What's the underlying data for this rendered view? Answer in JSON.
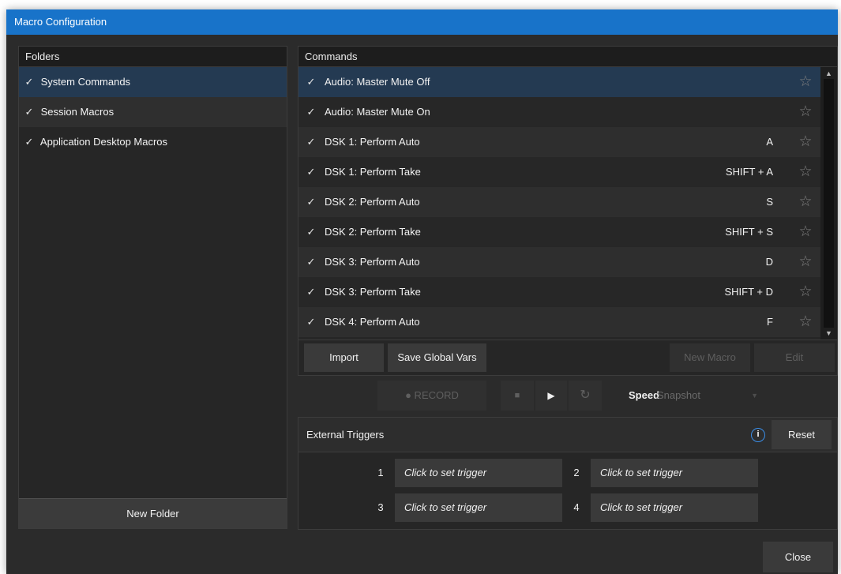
{
  "window": {
    "title": "Macro Configuration"
  },
  "folders": {
    "header": "Folders",
    "items": [
      {
        "check": "✓",
        "label": "System Commands"
      },
      {
        "check": "✓",
        "label": "Session Macros"
      },
      {
        "check": "✓",
        "label": "Application Desktop Macros"
      }
    ],
    "new_folder_label": "New Folder"
  },
  "commands": {
    "header": "Commands",
    "rows": [
      {
        "check": "✓",
        "label": "Audio: Master Mute Off",
        "key": "",
        "star": "☆"
      },
      {
        "check": "✓",
        "label": "Audio: Master Mute On",
        "key": "",
        "star": "☆"
      },
      {
        "check": "✓",
        "label": "DSK 1: Perform Auto",
        "key": "A",
        "star": "☆"
      },
      {
        "check": "✓",
        "label": "DSK 1: Perform Take",
        "key": "SHIFT + A",
        "star": "☆"
      },
      {
        "check": "✓",
        "label": "DSK 2: Perform Auto",
        "key": "S",
        "star": "☆"
      },
      {
        "check": "✓",
        "label": "DSK 2: Perform Take",
        "key": "SHIFT + S",
        "star": "☆"
      },
      {
        "check": "✓",
        "label": "DSK 3: Perform Auto",
        "key": "D",
        "star": "☆"
      },
      {
        "check": "✓",
        "label": "DSK 3: Perform Take",
        "key": "SHIFT + D",
        "star": "☆"
      },
      {
        "check": "✓",
        "label": "DSK 4: Perform Auto",
        "key": "F",
        "star": "☆"
      }
    ],
    "scroll_up": "▲",
    "scroll_down": "▼",
    "toolbar": {
      "import_label": "Import",
      "save_vars_label": "Save Global Vars",
      "new_macro_label": "New Macro",
      "edit_label": "Edit"
    }
  },
  "transport": {
    "record_label": "● RECORD",
    "stop_icon": "■",
    "play_icon": "▶",
    "loop_icon": "↻",
    "speed_label": "Speed",
    "speed_value": "Snapshot",
    "speed_arrow": "▼"
  },
  "external_triggers": {
    "header": "External Triggers",
    "info_glyph": "i",
    "reset_label": "Reset",
    "triggers": [
      {
        "number": "1",
        "label": "Click to set trigger"
      },
      {
        "number": "2",
        "label": "Click to set trigger"
      },
      {
        "number": "3",
        "label": "Click to set trigger"
      },
      {
        "number": "4",
        "label": "Click to set trigger"
      }
    ]
  },
  "footer": {
    "close_label": "Close"
  },
  "colors": {
    "titlebar": "#1873c9",
    "selection": "#243a52",
    "background": "#2b2b2b",
    "info_accent": "#3a8ee8"
  }
}
